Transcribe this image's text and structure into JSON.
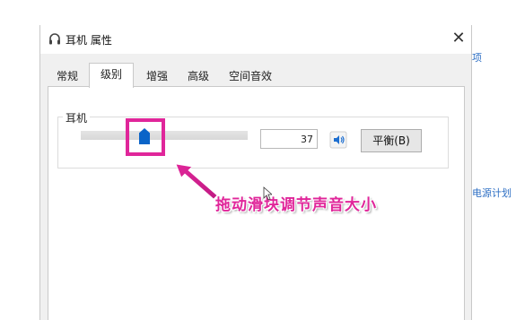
{
  "background": {
    "link_top": "项",
    "link_bottom": "电源计划"
  },
  "window": {
    "title": "耳机 属性",
    "close_glyph": "✕"
  },
  "tabs": [
    {
      "label": "常规",
      "active": false
    },
    {
      "label": "级别",
      "active": true
    },
    {
      "label": "增强",
      "active": false
    },
    {
      "label": "高级",
      "active": false
    },
    {
      "label": "空间音效",
      "active": false
    }
  ],
  "level": {
    "group_label": "耳机",
    "volume_value": "37",
    "volume_fraction": 0.37,
    "balance_label": "平衡(B)",
    "mute_icon": "speaker-icon"
  },
  "annotation": {
    "text": "拖动滑块调节声音大小",
    "color": "#e0269a"
  },
  "colors": {
    "accent": "#0a64c8",
    "annotation": "#e0269a"
  }
}
